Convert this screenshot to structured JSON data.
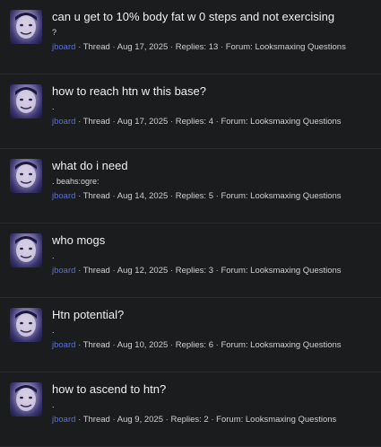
{
  "results": [
    {
      "title": "can u get to 10% body fat w 0 steps and not exercising",
      "snippet": "?",
      "user": "jboard",
      "type": "Thread",
      "date": "Aug 17, 2025",
      "replies": "Replies: 13",
      "forum": "Forum: Looksmaxing Questions"
    },
    {
      "title": "how to reach htn w this base?",
      "snippet": ".",
      "user": "jboard",
      "type": "Thread",
      "date": "Aug 17, 2025",
      "replies": "Replies: 4",
      "forum": "Forum: Looksmaxing Questions"
    },
    {
      "title": "what do i need",
      "snippet": ". beahs:ogre:",
      "user": "jboard",
      "type": "Thread",
      "date": "Aug 14, 2025",
      "replies": "Replies: 5",
      "forum": "Forum: Looksmaxing Questions"
    },
    {
      "title": "who mogs",
      "snippet": ".",
      "user": "jboard",
      "type": "Thread",
      "date": "Aug 12, 2025",
      "replies": "Replies: 3",
      "forum": "Forum: Looksmaxing Questions"
    },
    {
      "title": "Htn potential?",
      "snippet": ".",
      "user": "jboard",
      "type": "Thread",
      "date": "Aug 10, 2025",
      "replies": "Replies: 6",
      "forum": "Forum: Looksmaxing Questions"
    },
    {
      "title": "how to ascend to htn?",
      "snippet": ".",
      "user": "jboard",
      "type": "Thread",
      "date": "Aug 9, 2025",
      "replies": "Replies: 2",
      "forum": "Forum: Looksmaxing Questions"
    }
  ],
  "separator": "·",
  "colors": {
    "background": "#1b1c1e",
    "username": "#5b6fd6",
    "title": "#f0f0f0"
  }
}
